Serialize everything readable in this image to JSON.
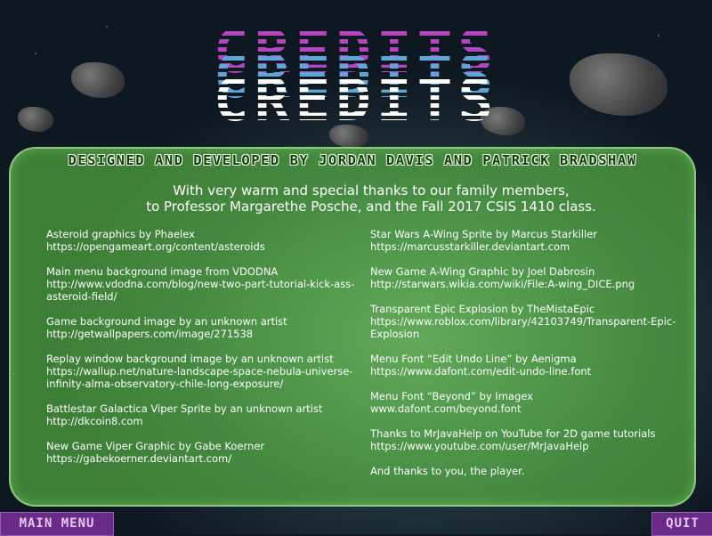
{
  "header": {
    "title": "CREDITS"
  },
  "subtitle": "DESIGNED AND DEVELOPED BY JORDAN DAVIS AND PATRICK BRADSHAW",
  "thanks": {
    "line1": "With very warm and special thanks to our family members,",
    "line2": "to Professor Margarethe Posche, and the Fall 2017 CSIS 1410 class."
  },
  "credits_left": [
    {
      "title": "Asteroid graphics by Phaelex",
      "link": "https://opengameart.org/content/asteroids"
    },
    {
      "title": "Main menu background image from VDODNA",
      "link": "http://www.vdodna.com/blog/new-two-part-tutorial-kick-ass-asteroid-field/"
    },
    {
      "title": "Game background image by an unknown artist",
      "link": "http://getwallpapers.com/image/271538"
    },
    {
      "title": "Replay window background image by an unknown artist",
      "link": "https://wallup.net/nature-landscape-space-nebula-universe-infinity-alma-observatory-chile-long-exposure/"
    },
    {
      "title": "Battlestar Galactica Viper Sprite by an unknown artist",
      "link": "http://dkcoin8.com"
    },
    {
      "title": "New Game Viper Graphic by Gabe Koerner",
      "link": "https://gabekoerner.deviantart.com/"
    }
  ],
  "credits_right": [
    {
      "title": "Star Wars A-Wing Sprite by Marcus Starkiller",
      "link": "https://marcusstarkiller.deviantart.com"
    },
    {
      "title": "New Game A-Wing Graphic by Joel Dabrosin",
      "link": "http://starwars.wikia.com/wiki/File:A-wing_DICE.png"
    },
    {
      "title": "Transparent Epic Explosion by TheMistaEpic",
      "link": "https://www.roblox.com/library/42103749/Transparent-Epic-Explosion"
    },
    {
      "title": "Menu Font “Edit Undo Line” by Aenigma",
      "link": "https://www.dafont.com/edit-undo-line.font"
    },
    {
      "title": "Menu Font “Beyond” by Imagex",
      "link": "www.dafont.com/beyond.font"
    },
    {
      "title": "Thanks to MrJavaHelp on YouTube for 2D game tutorials",
      "link": "https://www.youtube.com/user/MrJavaHelp"
    },
    {
      "title": "And thanks to you, the player.",
      "link": ""
    }
  ],
  "buttons": {
    "main_menu": "MAIN MENU",
    "quit": "QUIT"
  },
  "colors": {
    "panel": "#5cbe46",
    "button": "#6a2a88",
    "title_pink": "#c84ad0",
    "title_blue": "#5fa6d8"
  }
}
